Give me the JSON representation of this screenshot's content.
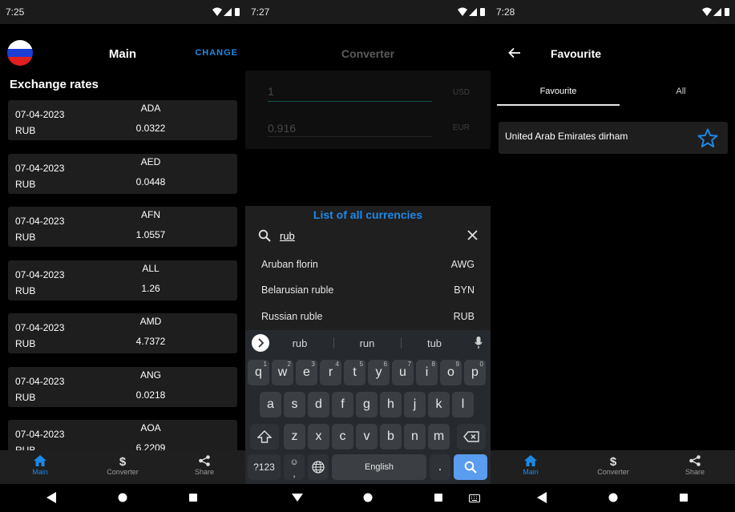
{
  "screen_main": {
    "status_time": "7:25",
    "title": "Main",
    "change_label": "CHANGE",
    "section_title": "Exchange rates",
    "flag_colors": [
      "#ffffff",
      "#1c3fd6",
      "#e0201f"
    ],
    "rates": [
      {
        "date": "07-04-2023",
        "base": "RUB",
        "code": "ADA",
        "value": "0.0322"
      },
      {
        "date": "07-04-2023",
        "base": "RUB",
        "code": "AED",
        "value": "0.0448"
      },
      {
        "date": "07-04-2023",
        "base": "RUB",
        "code": "AFN",
        "value": "1.0557"
      },
      {
        "date": "07-04-2023",
        "base": "RUB",
        "code": "ALL",
        "value": "1.26"
      },
      {
        "date": "07-04-2023",
        "base": "RUB",
        "code": "AMD",
        "value": "4.7372"
      },
      {
        "date": "07-04-2023",
        "base": "RUB",
        "code": "ANG",
        "value": "0.0218"
      },
      {
        "date": "07-04-2023",
        "base": "RUB",
        "code": "AOA",
        "value": "6.2209"
      }
    ]
  },
  "screen_converter": {
    "status_time": "7:27",
    "title": "Converter",
    "from_value": "1",
    "from_currency": "USD",
    "to_value": "0.916",
    "to_currency": "EUR",
    "sheet_title": "List of all currencies",
    "search_value": "rub",
    "results": [
      {
        "name": "Aruban florin",
        "code": "AWG"
      },
      {
        "name": "Belarusian ruble",
        "code": "BYN"
      },
      {
        "name": "Russian ruble",
        "code": "RUB"
      }
    ],
    "keyboard": {
      "suggestions": [
        "rub",
        "run",
        "tub"
      ],
      "row1": [
        "q",
        "w",
        "e",
        "r",
        "t",
        "y",
        "u",
        "i",
        "o",
        "p"
      ],
      "row1_hints": [
        "1",
        "2",
        "3",
        "4",
        "5",
        "6",
        "7",
        "8",
        "9",
        "0"
      ],
      "row2": [
        "a",
        "s",
        "d",
        "f",
        "g",
        "h",
        "j",
        "k",
        "l"
      ],
      "row3": [
        "z",
        "x",
        "c",
        "v",
        "b",
        "n",
        "m"
      ],
      "symbols_label": "?123",
      "comma_label": ",",
      "emoji_label": "☺",
      "space_label": "English",
      "period_label": "."
    }
  },
  "screen_favourite": {
    "status_time": "7:28",
    "title": "Favourite",
    "tabs": [
      "Favourite",
      "All"
    ],
    "items": [
      {
        "name": "United Arab Emirates dirham"
      }
    ]
  },
  "bottom_nav": {
    "main": "Main",
    "converter": "Converter",
    "share": "Share"
  },
  "colors": {
    "accent": "#1e88e5",
    "card": "#1e1e1e",
    "background": "#000000"
  }
}
